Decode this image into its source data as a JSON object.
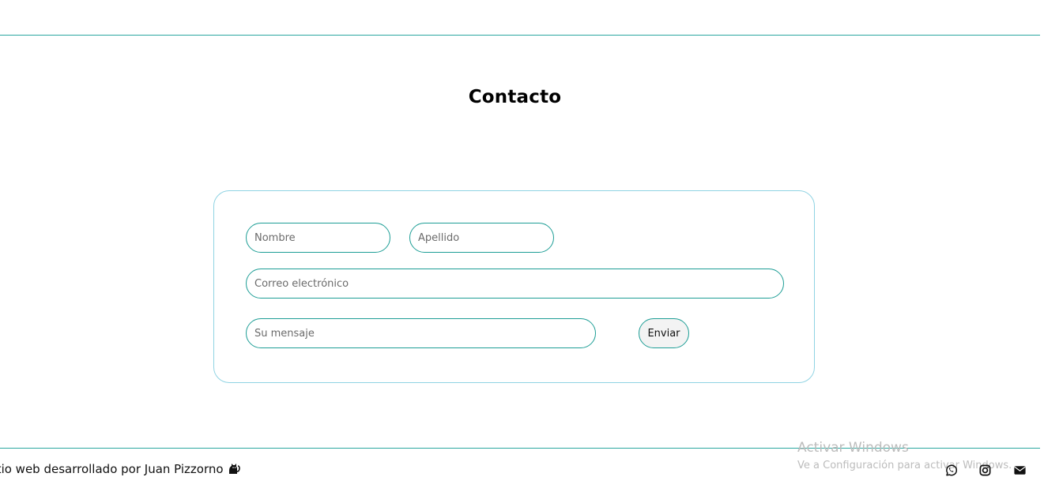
{
  "header": {
    "title": "Contacto"
  },
  "form": {
    "first_name_placeholder": "Nombre",
    "last_name_placeholder": "Apellido",
    "email_placeholder": "Correo electrónico",
    "message_placeholder": "Su mensaje",
    "submit_label": "Enviar"
  },
  "footer": {
    "credit": "Sitio web desarrollado por Juan Pizzorno",
    "credit_icon": "cat-icon",
    "social_links": [
      {
        "icon": "whatsapp-icon"
      },
      {
        "icon": "instagram-icon"
      },
      {
        "icon": "mail-icon"
      }
    ]
  },
  "watermark": {
    "title": "Activar Windows",
    "subtitle": "Ve a Configuración para activar Windows."
  },
  "colors": {
    "accent": "#1e9e96",
    "card_border": "#8fd3e3",
    "button_bg": "#f3f3f3",
    "text": "#111111"
  }
}
